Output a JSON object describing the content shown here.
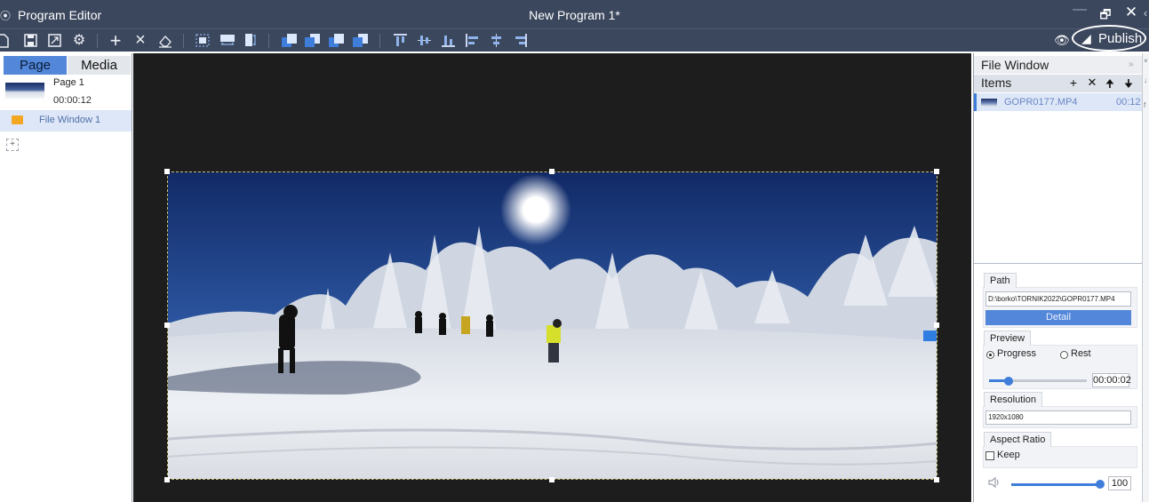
{
  "window": {
    "app_title": "Program Editor",
    "document_title": "New Program 1*",
    "minimize": "—",
    "restore": "🗗",
    "close": "✕",
    "extra": "‹"
  },
  "toolbar": {
    "publish_label": "Publish"
  },
  "left_panel": {
    "tabs": {
      "page": "Page",
      "media": "Media"
    },
    "page": {
      "name": "Page 1",
      "duration": "00:00:12"
    },
    "regions": [
      {
        "label": "File Window 1"
      }
    ],
    "add_symbol": "+"
  },
  "right_panel": {
    "title": "File Window",
    "more_symbol": "»",
    "items_label": "Items",
    "item_actions": {
      "add": "+",
      "delete": "✕",
      "up": "🠉",
      "down": "🠋"
    },
    "items": [
      {
        "name": "GOPR0177.MP4",
        "duration": "00:12"
      }
    ],
    "path": {
      "tab": "Path",
      "value": "D:\\borko\\TORNIK2022\\GOPR0177.MP4",
      "detail_button": "Detail"
    },
    "preview": {
      "tab": "Preview",
      "options": [
        "Progress",
        "Rest"
      ],
      "selected": "Progress",
      "time": "00:00:02",
      "position": 0.2
    },
    "resolution": {
      "tab": "Resolution",
      "value": "1920x1080"
    },
    "aspect_ratio": {
      "tab": "Aspect Ratio",
      "keep_label": "Keep",
      "keep_checked": false
    },
    "volume": {
      "value": "100",
      "level": 1.0
    }
  },
  "edge_strip": {
    "marks": [
      "×",
      "↓",
      "f"
    ]
  },
  "colors": {
    "titlebar": "#3b475d",
    "accent": "#5287d9",
    "selection": "#dde7f7",
    "canvas": "#1d1d1d"
  }
}
